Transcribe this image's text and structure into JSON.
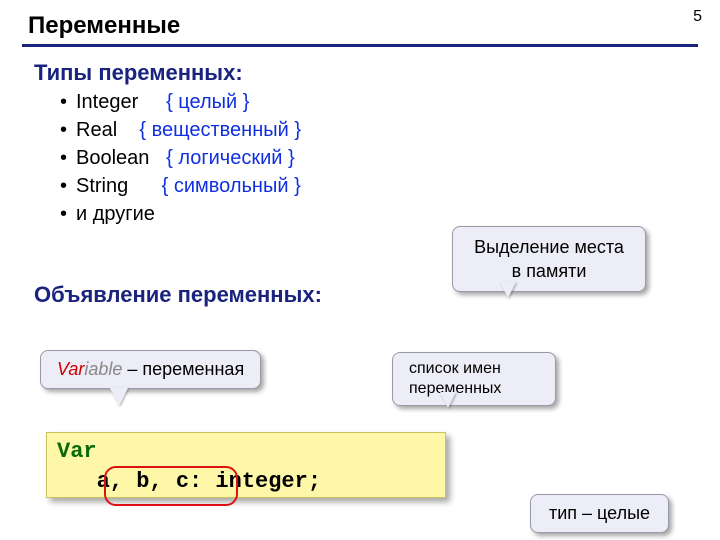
{
  "page_number": "5",
  "title": "Переменные",
  "section_types": "Типы переменных:",
  "types": [
    {
      "name": "Integer",
      "comment": "{ целый }"
    },
    {
      "name": "Real",
      "comment": "{ вещественный }"
    },
    {
      "name": "Boolean",
      "comment": "{ логический }"
    },
    {
      "name": "String",
      "comment": "{ символьный }"
    },
    {
      "name": "и другие",
      "comment": ""
    }
  ],
  "section_decl": "Объявление переменных:",
  "callout_memory": "Выделение места в памяти",
  "callout_variable_prefix": "Var",
  "callout_variable_suffix": "iable",
  "callout_variable_rest": " – переменная",
  "callout_names": "список имен переменных",
  "callout_type": "тип – целые",
  "code_keyword": "Var",
  "code_body": "   a, b, c: integer;"
}
